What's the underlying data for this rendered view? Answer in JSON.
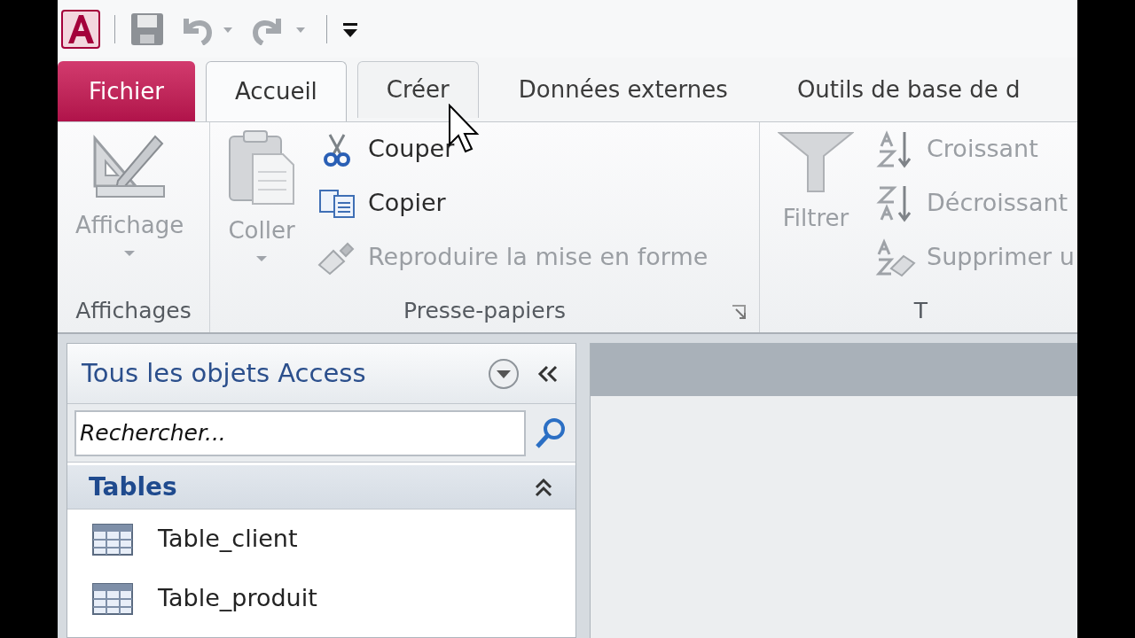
{
  "tabs": [
    {
      "label": "Fichier",
      "kind": "file",
      "selected": false,
      "hovered": false
    },
    {
      "label": "Accueil",
      "kind": "tab",
      "selected": true,
      "hovered": false
    },
    {
      "label": "Créer",
      "kind": "tab",
      "selected": false,
      "hovered": true
    },
    {
      "label": "Données externes",
      "kind": "tab",
      "selected": false,
      "hovered": false
    },
    {
      "label": "Outils de base de d",
      "kind": "tab",
      "selected": false,
      "hovered": false
    }
  ],
  "ribbon": {
    "groups": [
      {
        "label": "Affichages",
        "commands": [
          {
            "kind": "large",
            "label": "Affichage",
            "disabled": true,
            "dropdown": true
          }
        ]
      },
      {
        "label": "Presse-papiers",
        "launcher": true,
        "commands": [
          {
            "kind": "large",
            "label": "Coller",
            "disabled": true,
            "dropdown": true
          },
          {
            "kind": "small",
            "label": "Couper",
            "disabled": false
          },
          {
            "kind": "small",
            "label": "Copier",
            "disabled": false
          },
          {
            "kind": "small",
            "label": "Reproduire la mise en forme",
            "disabled": true
          }
        ]
      },
      {
        "label": "T",
        "commands": [
          {
            "kind": "large",
            "label": "Filtrer",
            "disabled": true
          },
          {
            "kind": "small",
            "label": "Croissant",
            "disabled": true
          },
          {
            "kind": "small",
            "label": "Décroissant",
            "disabled": true
          },
          {
            "kind": "small",
            "label": "Supprimer u",
            "disabled": true
          }
        ]
      }
    ]
  },
  "navigation_pane": {
    "title": "Tous les objets Access",
    "search": {
      "placeholder": "Rechercher..."
    },
    "groups": [
      {
        "label": "Tables",
        "expanded": true,
        "items": [
          {
            "label": "Table_client",
            "selected": false
          },
          {
            "label": "Table_produit",
            "selected": false
          }
        ]
      }
    ]
  }
}
